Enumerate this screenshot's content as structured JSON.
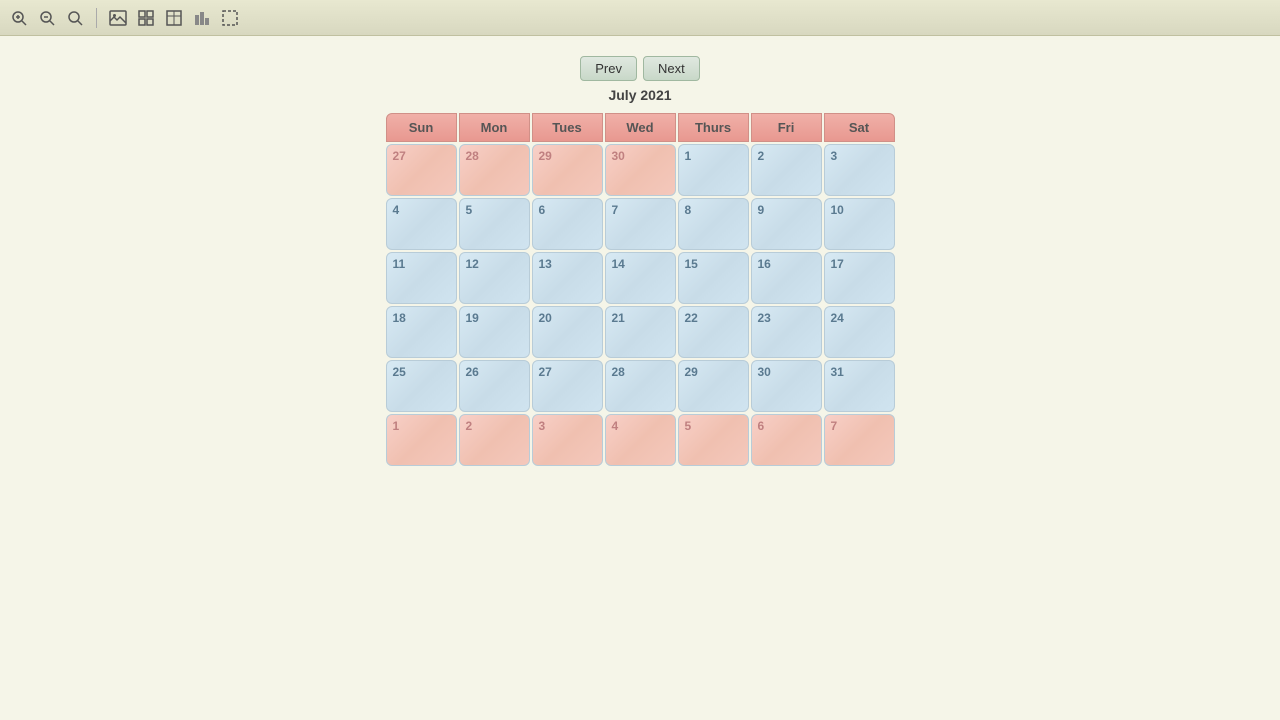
{
  "toolbar": {
    "icons": [
      {
        "name": "zoom-in-icon",
        "symbol": "🔍+"
      },
      {
        "name": "zoom-out-icon",
        "symbol": "🔍-"
      },
      {
        "name": "zoom-fit-icon",
        "symbol": "🔍"
      },
      {
        "name": "image-icon",
        "symbol": "🖼"
      },
      {
        "name": "grid-icon",
        "symbol": "⊞"
      },
      {
        "name": "table-icon",
        "symbol": "⊟"
      },
      {
        "name": "chart-icon",
        "symbol": "📊"
      },
      {
        "name": "selection-icon",
        "symbol": "⊡"
      }
    ]
  },
  "nav": {
    "prev_label": "Prev",
    "next_label": "Next"
  },
  "calendar": {
    "title": "July 2021",
    "headers": [
      "Sun",
      "Mon",
      "Tues",
      "Wed",
      "Thurs",
      "Fri",
      "Sat"
    ],
    "weeks": [
      [
        {
          "day": "27",
          "type": "other-month"
        },
        {
          "day": "28",
          "type": "other-month"
        },
        {
          "day": "29",
          "type": "other-month"
        },
        {
          "day": "30",
          "type": "other-month"
        },
        {
          "day": "1",
          "type": "current-month"
        },
        {
          "day": "2",
          "type": "current-month"
        },
        {
          "day": "3",
          "type": "current-month"
        }
      ],
      [
        {
          "day": "4",
          "type": "current-month"
        },
        {
          "day": "5",
          "type": "current-month"
        },
        {
          "day": "6",
          "type": "current-month"
        },
        {
          "day": "7",
          "type": "current-month"
        },
        {
          "day": "8",
          "type": "current-month"
        },
        {
          "day": "9",
          "type": "current-month"
        },
        {
          "day": "10",
          "type": "current-month"
        }
      ],
      [
        {
          "day": "11",
          "type": "current-month"
        },
        {
          "day": "12",
          "type": "current-month"
        },
        {
          "day": "13",
          "type": "current-month"
        },
        {
          "day": "14",
          "type": "current-month"
        },
        {
          "day": "15",
          "type": "current-month"
        },
        {
          "day": "16",
          "type": "current-month"
        },
        {
          "day": "17",
          "type": "current-month"
        }
      ],
      [
        {
          "day": "18",
          "type": "current-month"
        },
        {
          "day": "19",
          "type": "current-month"
        },
        {
          "day": "20",
          "type": "current-month"
        },
        {
          "day": "21",
          "type": "current-month"
        },
        {
          "day": "22",
          "type": "current-month"
        },
        {
          "day": "23",
          "type": "current-month"
        },
        {
          "day": "24",
          "type": "current-month"
        }
      ],
      [
        {
          "day": "25",
          "type": "current-month"
        },
        {
          "day": "26",
          "type": "current-month"
        },
        {
          "day": "27",
          "type": "current-month"
        },
        {
          "day": "28",
          "type": "current-month"
        },
        {
          "day": "29",
          "type": "current-month"
        },
        {
          "day": "30",
          "type": "current-month"
        },
        {
          "day": "31",
          "type": "current-month"
        }
      ],
      [
        {
          "day": "1",
          "type": "other-month"
        },
        {
          "day": "2",
          "type": "other-month"
        },
        {
          "day": "3",
          "type": "other-month"
        },
        {
          "day": "4",
          "type": "other-month"
        },
        {
          "day": "5",
          "type": "other-month"
        },
        {
          "day": "6",
          "type": "other-month"
        },
        {
          "day": "7",
          "type": "other-month"
        }
      ]
    ]
  }
}
